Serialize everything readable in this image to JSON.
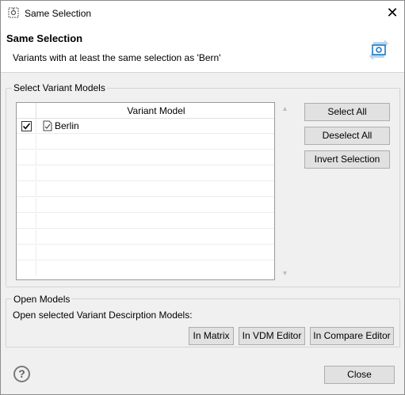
{
  "window": {
    "title": "Same Selection",
    "close_glyph": "✕"
  },
  "header": {
    "title": "Same Selection",
    "description": "Variants with at least the same selection as 'Bern'"
  },
  "variant_group": {
    "label": "Select Variant Models",
    "table": {
      "column_header": "Variant Model",
      "rows": [
        {
          "label": "Berlin",
          "checked": true
        }
      ]
    },
    "buttons": {
      "select_all": "Select All",
      "deselect_all": "Deselect All",
      "invert_selection": "Invert Selection"
    }
  },
  "open_group": {
    "label": "Open Models",
    "description": "Open selected Variant Descirption Models:",
    "buttons": {
      "in_matrix": "In Matrix",
      "in_vdm_editor": "In VDM Editor",
      "in_compare_editor": "In Compare Editor"
    }
  },
  "footer": {
    "help_glyph": "?",
    "close_label": "Close"
  },
  "icons": {
    "app": "settings-frame-icon",
    "banner": "variant-sync-icon",
    "row": "document-check-icon"
  },
  "colors": {
    "dialog_bg": "#f0f0f0",
    "button_bg": "#e1e1e1",
    "accent": "#1f7bc2"
  }
}
